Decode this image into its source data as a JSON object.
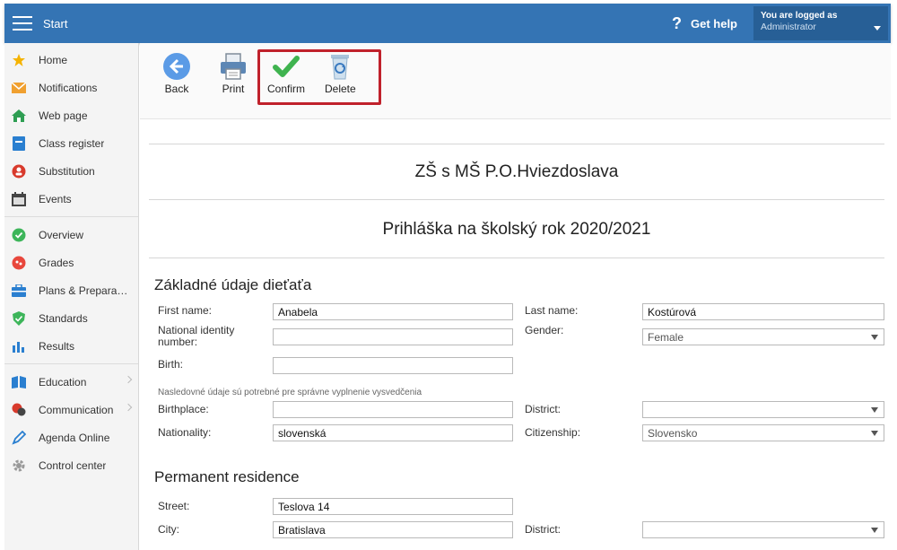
{
  "topbar": {
    "start_label": "Start",
    "help_icon": "?",
    "help_label": "Get help",
    "login_line1": "You are logged as",
    "login_line2": "Administrator",
    "color": "#3474b4"
  },
  "sidebar": {
    "items": [
      {
        "label": "Home",
        "icon": "star-icon"
      },
      {
        "label": "Notifications",
        "icon": "envelope-icon"
      },
      {
        "label": "Web page",
        "icon": "house-icon"
      },
      {
        "label": "Class register",
        "icon": "register-icon"
      },
      {
        "label": "Substitution",
        "icon": "person-icon"
      },
      {
        "label": "Events",
        "icon": "calendar-icon"
      },
      {
        "label": "Overview",
        "icon": "check-circle-icon"
      },
      {
        "label": "Grades",
        "icon": "grades-icon"
      },
      {
        "label": "Plans & Preparations",
        "icon": "briefcase-icon"
      },
      {
        "label": "Standards",
        "icon": "shield-check-icon"
      },
      {
        "label": "Results",
        "icon": "bar-chart-icon"
      },
      {
        "label": "Education",
        "icon": "book-icon"
      },
      {
        "label": "Communication",
        "icon": "chat-icon"
      },
      {
        "label": "Agenda Online",
        "icon": "pen-icon"
      },
      {
        "label": "Control center",
        "icon": "gear-icon"
      }
    ]
  },
  "toolbar": {
    "back_label": "Back",
    "print_label": "Print",
    "confirm_label": "Confirm",
    "delete_label": "Delete"
  },
  "form": {
    "school_name": "ZŠ s MŠ P.O.Hviezdoslava",
    "application_title": "Prihláška na školský rok 2020/2021",
    "basic_section": "Základné údaje dieťaťa",
    "first_name_label": "First name:",
    "first_name_value": "Anabela",
    "last_name_label": "Last name:",
    "last_name_value": "Kostúrová",
    "national_id_label": "National identity number:",
    "national_id_value": "",
    "gender_label": "Gender:",
    "gender_value": "Female",
    "birth_label": "Birth:",
    "birth_value": "",
    "note": "Nasledovné údaje sú potrebné pre správne vyplnenie vysvedčenia",
    "birthplace_label": "Birthplace:",
    "birthplace_value": "",
    "district_label": "District:",
    "district_value": "",
    "nationality_label": "Nationality:",
    "nationality_value": "slovenská",
    "citizenship_label": "Citizenship:",
    "citizenship_value": "Slovensko",
    "residence_section": "Permanent residence",
    "street_label": "Street:",
    "street_value": "Teslova 14",
    "city_label": "City:",
    "city_value": "Bratislava",
    "res_district_label": "District:",
    "res_district_value": ""
  }
}
